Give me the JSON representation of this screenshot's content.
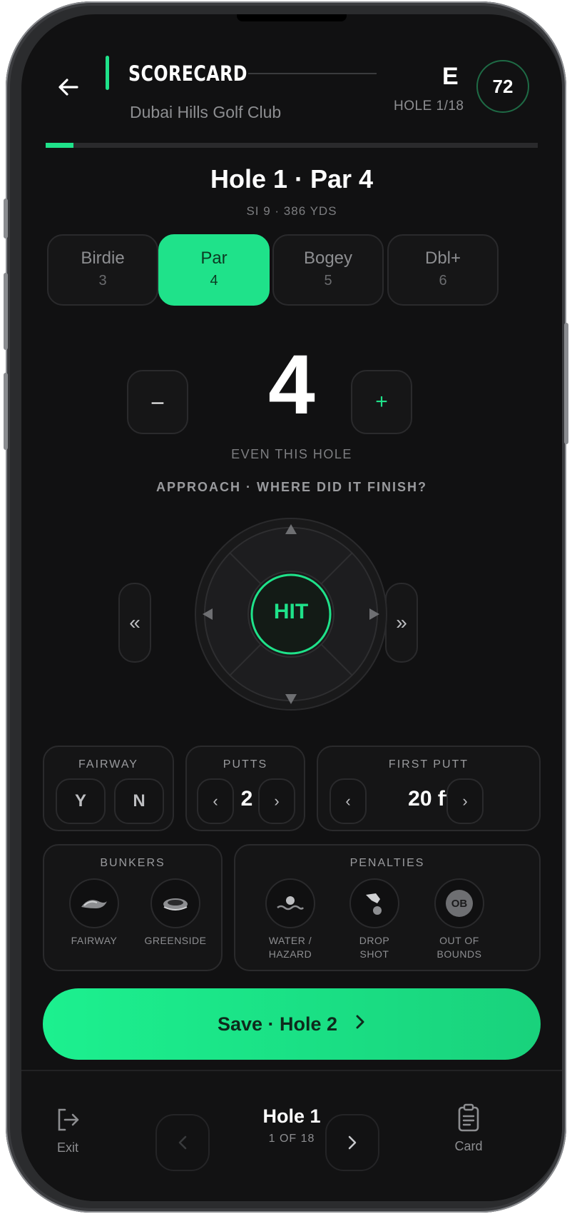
{
  "header": {
    "title": "SCORECARD",
    "course": "Dubai Hills Golf Club",
    "score_to_par": "E",
    "hole_progress": "HOLE 1/18",
    "total_score": "72",
    "progress_fraction": 0.056
  },
  "hole": {
    "title": "Hole 1 · Par 4",
    "subtitle": "SI 9 · 386 YDS"
  },
  "score_chips": [
    {
      "label": "Birdie",
      "strokes": "3",
      "active": false
    },
    {
      "label": "Par",
      "strokes": "4",
      "active": true
    },
    {
      "label": "Bogey",
      "strokes": "5",
      "active": false
    },
    {
      "label": "Dbl+",
      "strokes": "6",
      "active": false
    }
  ],
  "stepper": {
    "minus": "–",
    "plus": "+",
    "value": "4",
    "status": "EVEN THIS HOLE"
  },
  "approach": {
    "prompt": "APPROACH · WHERE DID IT FINISH?",
    "center_label": "HIT",
    "prev": "«",
    "next": "»"
  },
  "fairway": {
    "label": "FAIRWAY",
    "yes": "Y",
    "no": "N"
  },
  "putts": {
    "label": "PUTTS",
    "value": "2",
    "dec": "‹",
    "inc": "›"
  },
  "first_putt": {
    "label": "FIRST PUTT",
    "value": "20 ft",
    "dec": "‹",
    "inc": "›"
  },
  "bunkers": {
    "label": "BUNKERS",
    "options": [
      "FAIRWAY",
      "GREENSIDE"
    ]
  },
  "penalties": {
    "label": "PENALTIES",
    "options": [
      {
        "line1": "WATER /",
        "line2": "HAZARD"
      },
      {
        "line1": "DROP",
        "line2": "SHOT"
      },
      {
        "line1": "OUT OF",
        "line2": "BOUNDS"
      }
    ],
    "ob_badge": "OB"
  },
  "save_button": "Save · Hole 2",
  "bottom_nav": {
    "exit": "Exit",
    "hole": "Hole 1",
    "hole_count": "1 OF 18",
    "card": "Card"
  },
  "colors": {
    "accent": "#1fe28a",
    "background": "#111112",
    "muted": "#8d8e91"
  }
}
